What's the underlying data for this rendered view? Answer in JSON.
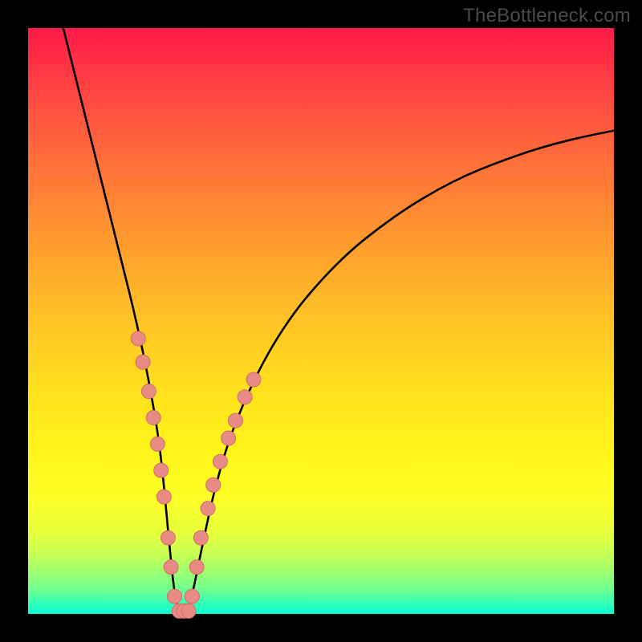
{
  "watermark": "TheBottleneck.com",
  "colors": {
    "curve": "#000000",
    "marker_fill": "#e88b84",
    "marker_stroke": "#d36e67",
    "background_black": "#000000"
  },
  "chart_data": {
    "type": "line",
    "title": "",
    "xlabel": "",
    "ylabel": "",
    "xlim": [
      0,
      100
    ],
    "ylim": [
      0,
      100
    ],
    "series": [
      {
        "name": "bottleneck-curve",
        "x": [
          6,
          8,
          10,
          12,
          14,
          16,
          18,
          20,
          22,
          23,
          24,
          25,
          26,
          27,
          28,
          30,
          32,
          35,
          40,
          45,
          50,
          55,
          60,
          65,
          70,
          75,
          80,
          85,
          90,
          95,
          100
        ],
        "y": [
          100,
          92,
          84,
          76,
          68,
          60,
          52,
          43,
          32,
          24,
          13,
          3,
          0,
          0,
          3,
          13,
          22,
          32,
          43,
          51,
          57,
          62,
          66,
          69.5,
          72.5,
          75,
          77,
          78.8,
          80.3,
          81.5,
          82.5
        ]
      }
    ],
    "markers": {
      "name": "highlight-points",
      "points": [
        {
          "x": 18.8,
          "y": 47
        },
        {
          "x": 19.6,
          "y": 43
        },
        {
          "x": 20.6,
          "y": 38
        },
        {
          "x": 21.4,
          "y": 33.5
        },
        {
          "x": 22.1,
          "y": 29
        },
        {
          "x": 22.7,
          "y": 24.5
        },
        {
          "x": 23.2,
          "y": 20
        },
        {
          "x": 23.9,
          "y": 13
        },
        {
          "x": 24.4,
          "y": 8
        },
        {
          "x": 25.0,
          "y": 3
        },
        {
          "x": 25.8,
          "y": 0.5
        },
        {
          "x": 26.6,
          "y": 0.5
        },
        {
          "x": 27.4,
          "y": 0.5
        },
        {
          "x": 28.0,
          "y": 3
        },
        {
          "x": 28.8,
          "y": 8
        },
        {
          "x": 29.5,
          "y": 13
        },
        {
          "x": 30.7,
          "y": 18
        },
        {
          "x": 31.6,
          "y": 22
        },
        {
          "x": 32.8,
          "y": 26
        },
        {
          "x": 34.2,
          "y": 30
        },
        {
          "x": 35.4,
          "y": 33
        },
        {
          "x": 37.0,
          "y": 37
        },
        {
          "x": 38.5,
          "y": 40
        }
      ]
    }
  }
}
